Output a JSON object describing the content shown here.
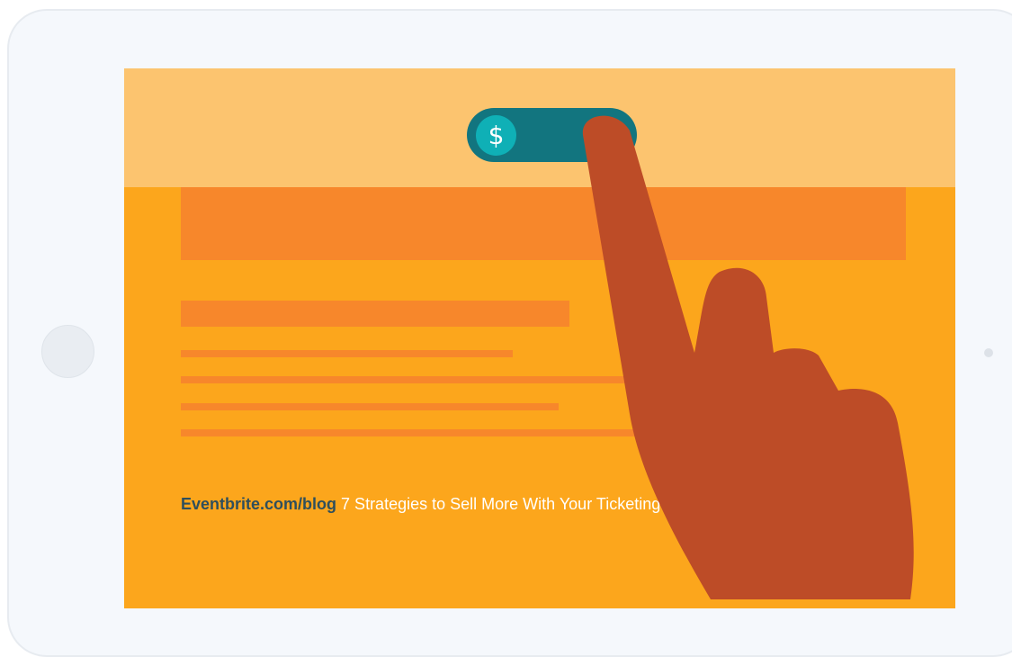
{
  "toggle": {
    "symbol": "$"
  },
  "caption": {
    "brand": "Eventbrite.com/blog",
    "title": "7 Strategies to Sell More With Your Ticketing & Registration Tech"
  },
  "colors": {
    "tablet_frame": "#f5f8fc",
    "screen_header": "#fcc46f",
    "screen_body": "#fca61c",
    "content_bars": "#f7872b",
    "toggle_track": "#12757f",
    "toggle_knob": "#0fb0b6",
    "hand": "#bd4c27",
    "brand_text": "#2f4f5c"
  }
}
